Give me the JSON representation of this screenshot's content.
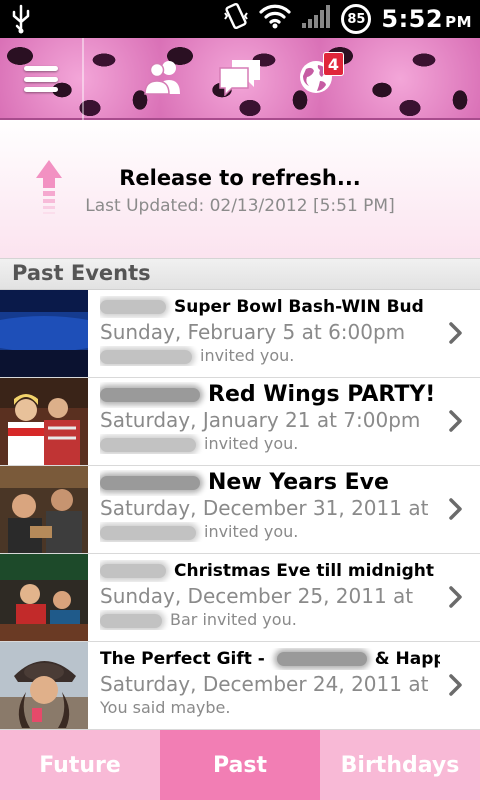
{
  "status_bar": {
    "usb_icon": "usb-icon",
    "vibrate_icon": "vibrate-icon",
    "wifi_icon": "wifi-icon",
    "signal_icon": "signal-icon",
    "battery_level": "85",
    "time": "5:52",
    "ampm": "PM"
  },
  "action_bar": {
    "menu_icon": "menu-icon",
    "friends_icon": "friends-icon",
    "messages_icon": "messages-icon",
    "notifications_icon": "globe-icon",
    "notifications_badge": "4",
    "colors": {
      "pink": "#e68ac6",
      "spots": "#2a1022"
    }
  },
  "refresh": {
    "title": "Release to refresh...",
    "last_updated": "Last Updated: 02/13/2012 [5:51 PM]"
  },
  "section": {
    "title": "Past Events"
  },
  "events": [
    {
      "title_suffix": "Super Bowl Bash-WIN Bud",
      "date": "Sunday, February 5 at 6:00pm",
      "status_suffix": "invited you.",
      "thumb": "bud-light-banner"
    },
    {
      "title_suffix": "Red Wings PARTY!",
      "date": "Saturday, January 21 at 7:00pm",
      "status_suffix": "invited you.",
      "thumb": "party-photo"
    },
    {
      "title_suffix": "New Years Eve",
      "date": "Saturday, December 31, 2011 at",
      "status_suffix": "invited you.",
      "thumb": "bar-photo"
    },
    {
      "title_suffix": "Christmas Eve till midnight -",
      "date": "Sunday, December 25, 2011 at",
      "status_suffix": "Bar invited you.",
      "thumb": "christmas-photo"
    },
    {
      "title_prefix": "The Perfect Gift -",
      "title_suffix": "& Happy",
      "date": "Saturday, December 24, 2011 at",
      "status": "You said maybe.",
      "thumb": "portrait-photo"
    }
  ],
  "tabs": [
    {
      "label": "Future"
    },
    {
      "label": "Past"
    },
    {
      "label": "Birthdays"
    }
  ],
  "colors": {
    "tab": "#f8b9d6",
    "tab_active": "#f27eb4"
  }
}
